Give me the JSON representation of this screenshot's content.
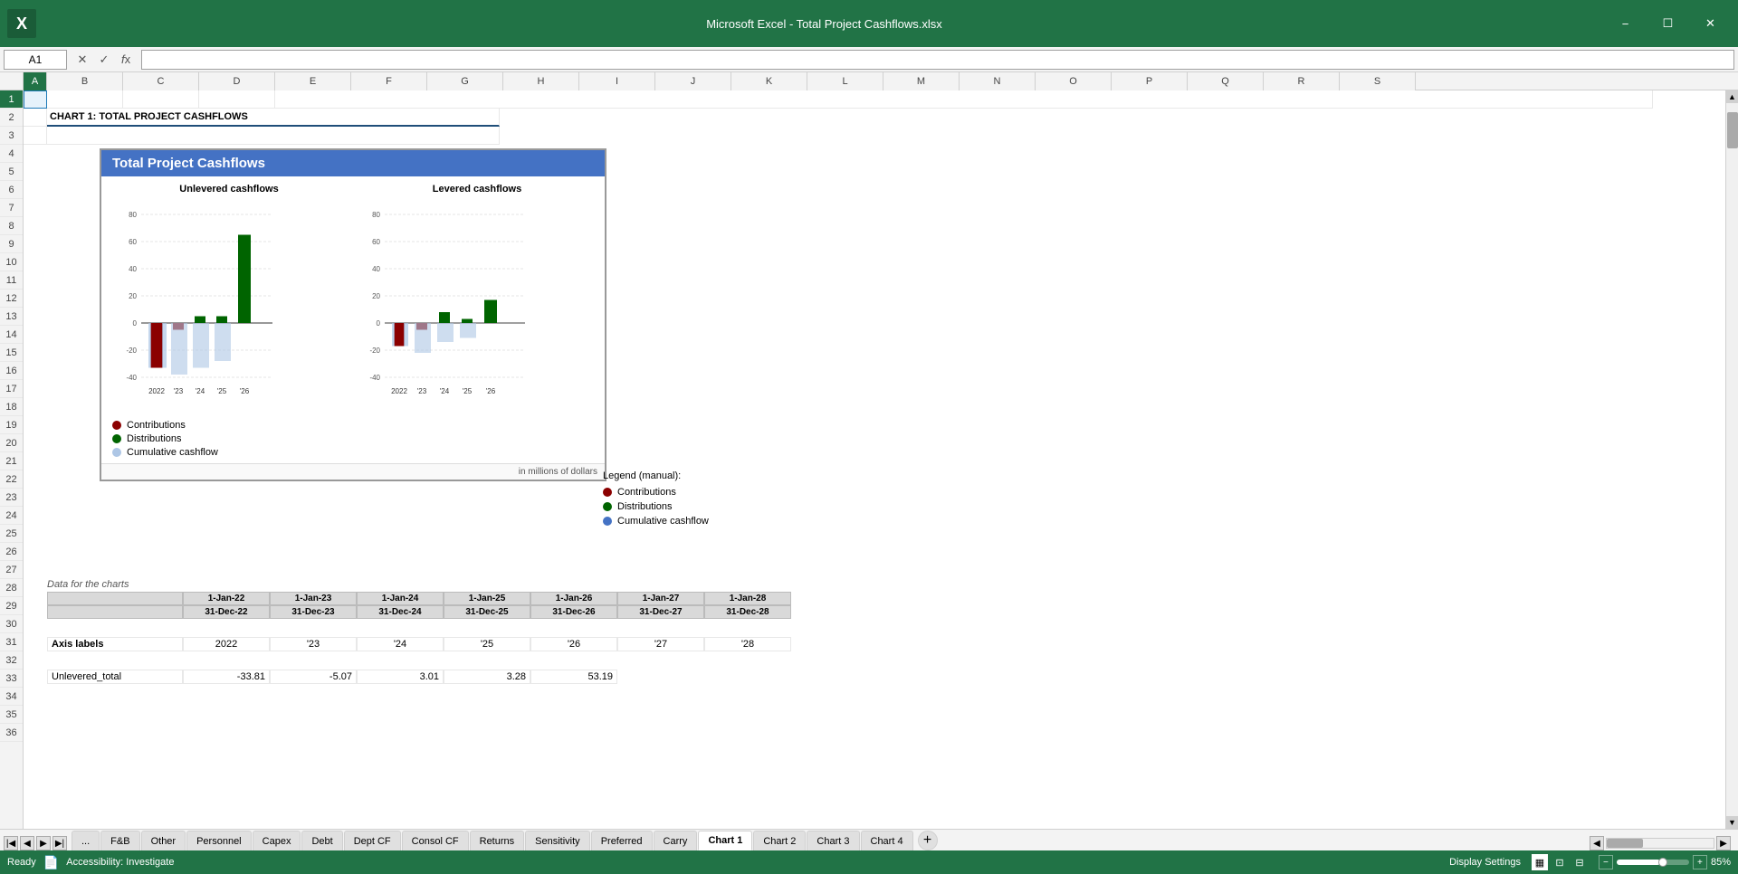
{
  "app": {
    "title": "Microsoft Excel - Total Project Cashflows.xlsx",
    "cell_ref": "A1",
    "formula": ""
  },
  "ribbon": {
    "cell_ref": "A1",
    "formula": ""
  },
  "col_headers": [
    "A",
    "B",
    "C",
    "D",
    "E",
    "F",
    "G",
    "H",
    "I",
    "J",
    "K",
    "L",
    "M",
    "N",
    "O",
    "P",
    "Q",
    "R",
    "S"
  ],
  "chart": {
    "title": "Total Project Cashflows",
    "section1_title": "Unlevered cashflows",
    "section2_title": "Levered cashflows",
    "footnote": "in millions of dollars",
    "legend": [
      {
        "label": "Contributions",
        "color": "#8B0000"
      },
      {
        "label": "Distributions",
        "color": "#006400"
      },
      {
        "label": "Cumulative cashflow",
        "color": "#6699CC"
      }
    ],
    "years": [
      "2022",
      "'23",
      "'24",
      "'25",
      "'26"
    ],
    "y_ticks": [
      "80",
      "60",
      "40",
      "20",
      "0",
      "-20",
      "-40"
    ],
    "unlevered": {
      "contributions": [
        -33,
        -5,
        0,
        0,
        0
      ],
      "distributions": [
        0,
        0,
        5,
        5,
        65
      ],
      "cumulative": [
        -33,
        -38,
        -33,
        -28,
        37
      ]
    },
    "levered": {
      "contributions": [
        -17,
        -5,
        0,
        0,
        0
      ],
      "distributions": [
        0,
        0,
        8,
        3,
        17
      ],
      "cumulative": [
        -17,
        -22,
        -14,
        -11,
        6
      ]
    }
  },
  "ext_legend": {
    "title": "Legend (manual):",
    "items": [
      {
        "label": "Contributions",
        "color": "#8B0000"
      },
      {
        "label": "Distributions",
        "color": "#006400"
      },
      {
        "label": "Cumulative cashflow",
        "color": "#4472C4"
      }
    ]
  },
  "cell_title": "CHART 1: TOTAL PROJECT CASHFLOWS",
  "data_section": {
    "label": "Data for the charts",
    "headers1": [
      "",
      "1-Jan-22",
      "1-Jan-23",
      "1-Jan-24",
      "1-Jan-25",
      "1-Jan-26",
      "1-Jan-27",
      "1-Jan-28"
    ],
    "headers2": [
      "",
      "31-Dec-22",
      "31-Dec-23",
      "31-Dec-24",
      "31-Dec-25",
      "31-Dec-26",
      "31-Dec-27",
      "31-Dec-28"
    ],
    "axis_row_label": "Axis labels",
    "axis_years": [
      "2022",
      "'23",
      "'24",
      "'25",
      "'26",
      "'27",
      "'28"
    ],
    "data_row_label": "Unlevered_total",
    "data_values": [
      "-33.81",
      "-5.07",
      "3.01",
      "3.28",
      "53.19"
    ]
  },
  "sheet_tabs": [
    {
      "label": "...",
      "active": false
    },
    {
      "label": "F&B",
      "active": false
    },
    {
      "label": "Other",
      "active": false
    },
    {
      "label": "Personnel",
      "active": false
    },
    {
      "label": "Capex",
      "active": false
    },
    {
      "label": "Debt",
      "active": false
    },
    {
      "label": "Dept CF",
      "active": false
    },
    {
      "label": "Consol CF",
      "active": false
    },
    {
      "label": "Returns",
      "active": false
    },
    {
      "label": "Sensitivity",
      "active": false
    },
    {
      "label": "Preferred",
      "active": false
    },
    {
      "label": "Carry",
      "active": false
    },
    {
      "label": "Chart 1",
      "active": true
    },
    {
      "label": "Chart 2",
      "active": false
    },
    {
      "label": "Chart 3",
      "active": false
    },
    {
      "label": "Chart 4",
      "active": false
    }
  ],
  "status": {
    "ready": "Ready",
    "accessibility": "Accessibility: Investigate",
    "display_settings": "Display Settings",
    "zoom": "85%",
    "view_normal": "Normal",
    "view_page": "Page Layout",
    "view_preview": "Page Break Preview"
  },
  "row_numbers": [
    "1",
    "2",
    "3",
    "4",
    "5",
    "6",
    "7",
    "8",
    "9",
    "10",
    "11",
    "12",
    "13",
    "14",
    "15",
    "16",
    "17",
    "18",
    "19",
    "20",
    "21",
    "22",
    "23",
    "24",
    "25",
    "26",
    "27",
    "28",
    "29",
    "30",
    "31",
    "32",
    "33",
    "34",
    "35",
    "36"
  ]
}
